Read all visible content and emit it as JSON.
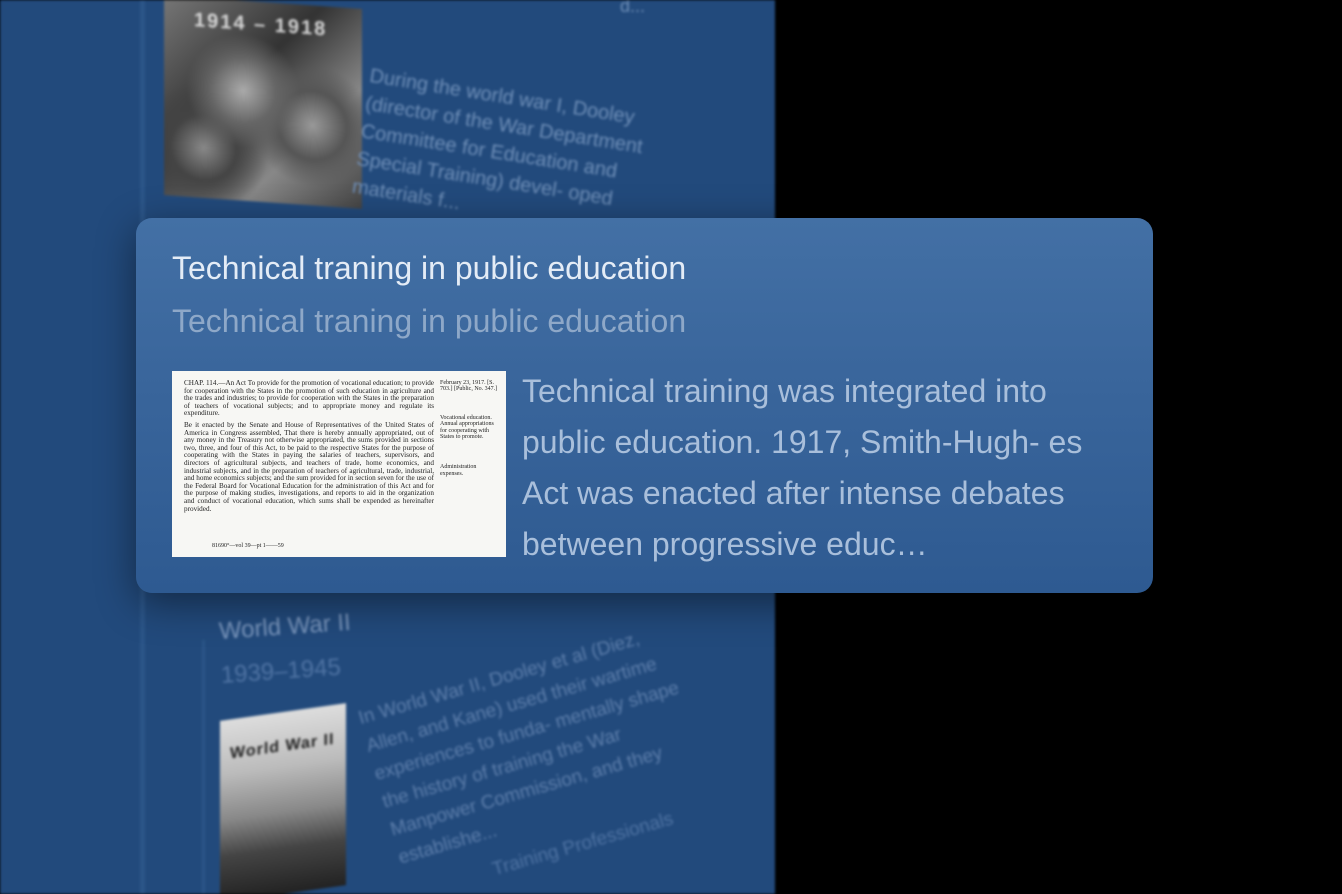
{
  "background": {
    "top_card": {
      "image_label": "1914 – 1918",
      "text": "During the world war I, Dooley (director of the War Department Committee for Education and Special Training) devel- oped materials f...",
      "ellipsis": "d..."
    },
    "ww2_card": {
      "title": "World War II",
      "years": "1939–1945",
      "image_label": "World War II",
      "text": "In World War II, Dooley et al (Diez, Allen, and Kane) used their wartime experiences to funda- mentally shape the history of training the War Manpower Commission, and they establishe...",
      "next_title": "Training Professionals"
    }
  },
  "focus_card": {
    "title": "Technical traning in public education",
    "subtitle": "Technical traning in public education",
    "description": "Technical training was integrated into public education. 1917, Smith-Hugh- es Act was enacted after intense debates between progressive educ…",
    "document": {
      "header": "CHAP. 114.—An Act To provide for the promotion of vocational education; to provide for cooperation with the States in the promotion of such education in agriculture and the trades and industries; to provide for cooperation with the States in the preparation of teachers of vocational subjects; and to appropriate money and regulate its expenditure.",
      "body": "Be it enacted by the Senate and House of Representatives of the United States of America in Congress assembled, That there is hereby annually appropriated, out of any money in the Treasury not otherwise appropriated, the sums provided in sections two, three, and four of this Act, to be paid to the respective States for the purpose of cooperating with the States in paying the salaries of teachers, supervisors, and directors of agricultural subjects, and teachers of trade, home economics, and industrial subjects, and in the preparation of teachers of agricultural, trade, industrial, and home economics subjects; and the sum provided for in section seven for the use of the Federal Board for Vocational Education for the administration of this Act and for the purpose of making studies, investigations, and reports to aid in the organization and conduct of vocational education, which sums shall be expended as hereinafter provided.",
      "side_date": "February 23, 1917. [S. 703.] [Public, No. 347.]",
      "side_note": "Vocational education. Annual appropriations for cooperating with States to promote.",
      "side_note2": "Administration expenses.",
      "footer": "81690°—vol 39—pt 1——59"
    }
  }
}
